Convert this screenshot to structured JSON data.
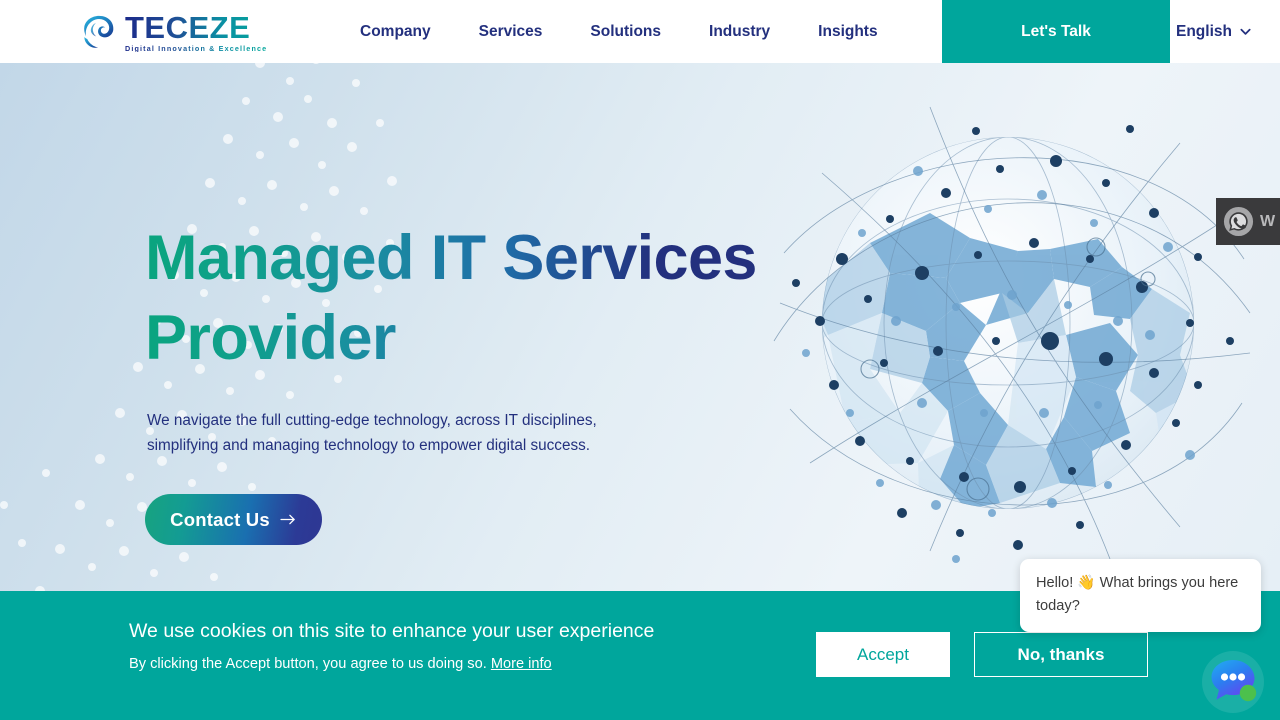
{
  "header": {
    "logo": {
      "name": "TECEZE",
      "tagline": "Digital Innovation & Excellence",
      "mark": "swirl-icon"
    },
    "nav_items": [
      {
        "label": "Company"
      },
      {
        "label": "Services"
      },
      {
        "label": "Solutions"
      },
      {
        "label": "Industry"
      },
      {
        "label": "Insights"
      }
    ],
    "cta": {
      "label": "Let's Talk",
      "bg_color": "#00a69c",
      "text_color": "#ffffff"
    },
    "language": {
      "label": "English",
      "icon": "chevron-down-icon"
    }
  },
  "hero": {
    "title": "Managed IT Services Provider",
    "title_line1": "Managed IT Services",
    "title_line2": "Provider",
    "subtitle_line1": "We navigate the full cutting-edge technology, across IT disciplines,",
    "subtitle_line2": "simplifying and managing technology to empower digital success.",
    "button": {
      "label": "Contact Us",
      "icon": "arrow-right-icon"
    },
    "illustration": "globe-network-icon",
    "gradient_start": "#0aa57e",
    "gradient_end": "#23307e"
  },
  "whatsapp_widget": {
    "icon": "whatsapp-icon",
    "label": "W",
    "bg_color": "#3a3a3c"
  },
  "cookie_banner": {
    "title": "We use cookies on this site to enhance your user experience",
    "description": "By clicking the Accept button, you agree to us doing so.",
    "more_info_label": "More info",
    "accept_label": "Accept",
    "decline_label": "No, thanks",
    "bg_color": "#00a69c"
  },
  "chat_widget": {
    "message": "Hello! 👋 What brings you here today?",
    "launcher_icon": "chat-bubble-icon",
    "status_color": "#4caf50"
  }
}
